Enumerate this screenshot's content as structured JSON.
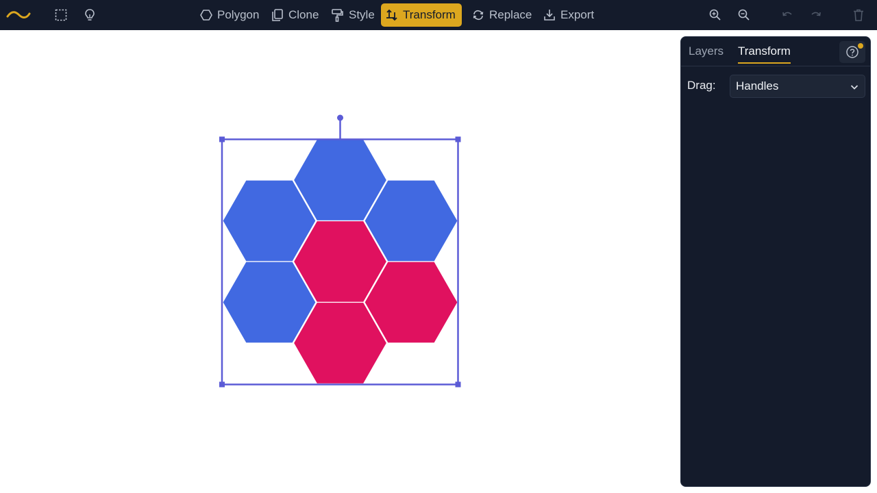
{
  "toolbar": {
    "tools": [
      {
        "id": "polygon",
        "label": "Polygon",
        "icon": "hexagon-outline-icon"
      },
      {
        "id": "clone",
        "label": "Clone",
        "icon": "clone-icon"
      },
      {
        "id": "style",
        "label": "Style",
        "icon": "paint-roller-icon"
      },
      {
        "id": "transform",
        "label": "Transform",
        "icon": "transform-icon",
        "active": true
      },
      {
        "id": "replace",
        "label": "Replace",
        "icon": "replace-icon"
      },
      {
        "id": "export",
        "label": "Export",
        "icon": "download-icon"
      }
    ],
    "left_icons": [
      "logo-icon",
      "select-rectangle-icon",
      "lightbulb-icon"
    ],
    "right_icons": [
      "zoom-in-icon",
      "zoom-out-icon",
      "undo-icon",
      "redo-icon",
      "trash-icon"
    ]
  },
  "panel": {
    "tabs": [
      {
        "label": "Layers",
        "active": false
      },
      {
        "label": "Transform",
        "active": true
      }
    ],
    "drag_label": "Drag:",
    "drag_value": "Handles"
  },
  "canvas": {
    "shapes": [
      {
        "type": "hexagon",
        "color": "#4169e1"
      },
      {
        "type": "hexagon",
        "color": "#4169e1"
      },
      {
        "type": "hexagon",
        "color": "#4169e1"
      },
      {
        "type": "hexagon",
        "color": "#4169e1"
      },
      {
        "type": "hexagon",
        "color": "#e0115f"
      },
      {
        "type": "hexagon",
        "color": "#e0115f"
      },
      {
        "type": "hexagon",
        "color": "#e0115f"
      }
    ]
  },
  "colors": {
    "toolbar_bg": "#141b2b",
    "accent": "#dca71f",
    "selection": "#5b5bd6",
    "blue_hex": "#4169e1",
    "red_hex": "#e0115f"
  }
}
